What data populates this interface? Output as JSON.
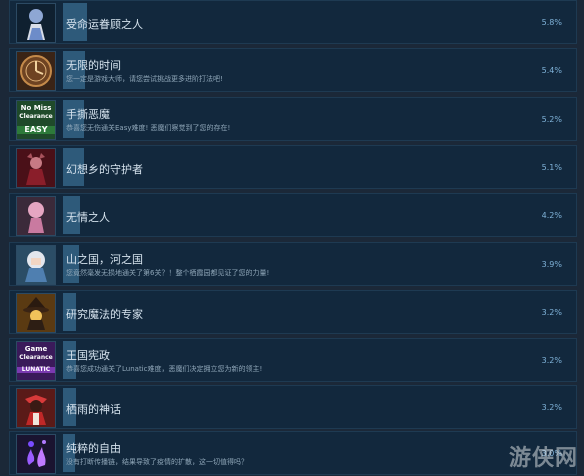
{
  "achievements": [
    {
      "title": "受命运眷顾之人",
      "desc": "",
      "pct": "5.8%",
      "fill": 0.058,
      "icon": "blue-haired-girl-portrait-icon"
    },
    {
      "title": "无限的时间",
      "desc": "您一定是游戏大师，请您尝试挑战更多进阶打法吧!",
      "pct": "5.4%",
      "fill": 0.054,
      "icon": "clock-face-icon"
    },
    {
      "title": "手撕恶魔",
      "desc": "恭喜您无伤通关Easy难度! 恶魔们察觉到了您的存在!",
      "pct": "5.2%",
      "fill": 0.052,
      "icon": "no-miss-clearance-easy-badge-icon",
      "badge": {
        "top": "No Miss",
        "mid": "Clearance",
        "bottom": "EASY"
      }
    },
    {
      "title": "幻想乡的守护者",
      "desc": "",
      "pct": "5.1%",
      "fill": 0.051,
      "icon": "red-robed-figure-portrait-icon"
    },
    {
      "title": "无情之人",
      "desc": "",
      "pct": "4.2%",
      "fill": 0.042,
      "icon": "pink-haired-girl-portrait-icon"
    },
    {
      "title": "山之国，河之国",
      "desc": "您竟然毫发无损地通关了第6关？！整个栖霞园都见证了您的力量!",
      "pct": "3.9%",
      "fill": 0.039,
      "icon": "white-haired-girl-portrait-icon"
    },
    {
      "title": "研究魔法的专家",
      "desc": "",
      "pct": "3.2%",
      "fill": 0.032,
      "icon": "witch-hat-portrait-icon"
    },
    {
      "title": "王国宪政",
      "desc": "恭喜您成功通关了Lunatic难度，恶魔们决定拥立您为新的领主!",
      "pct": "3.2%",
      "fill": 0.032,
      "icon": "game-clearance-lunatic-badge-icon",
      "badge": {
        "top": "Game",
        "mid": "Clearance",
        "bottom": "LUNATIC"
      }
    },
    {
      "title": "栖雨的神话",
      "desc": "",
      "pct": "3.2%",
      "fill": 0.032,
      "icon": "red-shrine-maiden-portrait-icon"
    },
    {
      "title": "纯粹的自由",
      "desc": "没有打断传播链，结果导致了疫情的扩散，这一切值得吗？",
      "pct": "3.0%",
      "fill": 0.03,
      "icon": "purple-flame-crystals-icon"
    }
  ],
  "watermark": "游侠网"
}
